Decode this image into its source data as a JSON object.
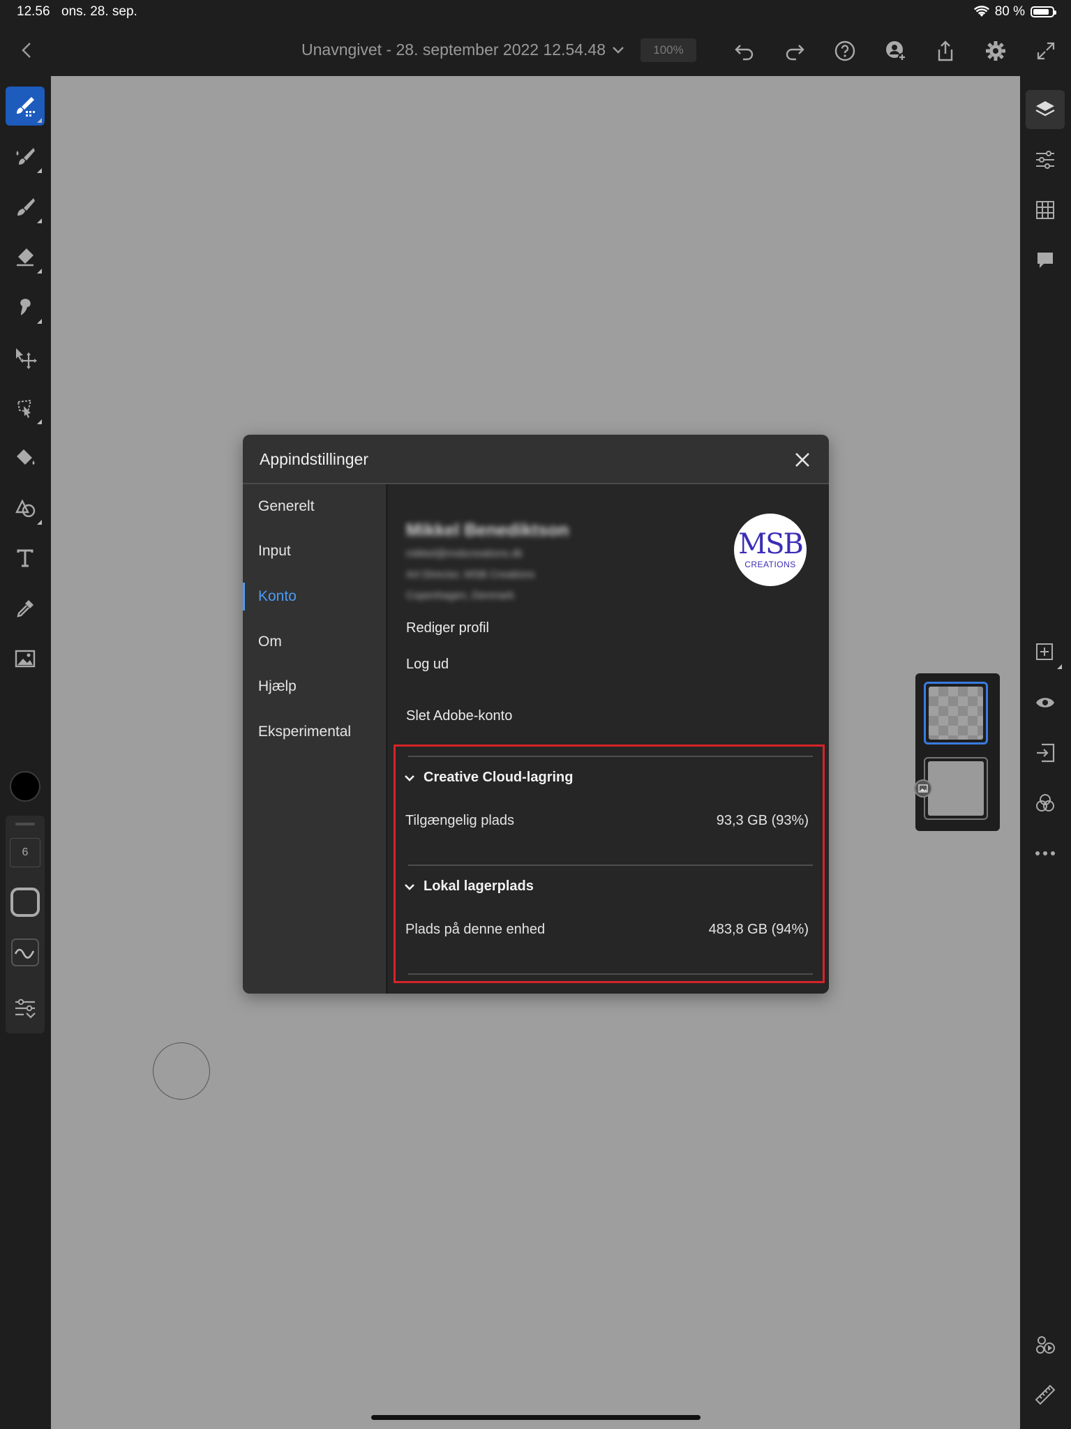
{
  "status_bar": {
    "time": "12.56",
    "date": "ons. 28. sep.",
    "battery": "80 %"
  },
  "app_bar": {
    "document_title": "Unavngivet - 28. september 2022 12.54.48",
    "zoom": "100%"
  },
  "left_toolbar": {
    "brush_size": "6",
    "tools": [
      "pixel-brush",
      "live-brush",
      "vector-brush",
      "eraser",
      "smudge",
      "move",
      "selection",
      "fill",
      "shape",
      "text",
      "eyedropper",
      "image"
    ],
    "active_tool": "pixel-brush"
  },
  "right_toolbar": {
    "icons": [
      "layers",
      "properties",
      "grid",
      "comments",
      "add-layer",
      "visibility",
      "import",
      "blend",
      "more",
      "share-livestream",
      "ruler"
    ]
  },
  "dialog": {
    "title": "Appindstillinger",
    "nav": [
      {
        "label": "Generelt"
      },
      {
        "label": "Input"
      },
      {
        "label": "Konto"
      },
      {
        "label": "Om"
      },
      {
        "label": "Hjælp"
      },
      {
        "label": "Eksperimental"
      }
    ],
    "active_nav": "Konto",
    "profile": {
      "name": "Mikkel Benediktson",
      "email": "mikkel@msbcreations.dk",
      "role": "Art Director, MSB Creations",
      "location": "Copenhagen, Denmark",
      "avatar_monogram": "MSB",
      "avatar_caption": "CREATIONS"
    },
    "account_links": {
      "edit_profile": "Rediger profil",
      "logout": "Log ud",
      "delete_account": "Slet Adobe-konto"
    },
    "storage": {
      "cloud": {
        "heading": "Creative Cloud-lagring",
        "label": "Tilgængelig plads",
        "value": "93,3 GB (93%)"
      },
      "local": {
        "heading": "Lokal lagerplads",
        "label": "Plads på denne enhed",
        "value": "483,8 GB (94%)"
      }
    }
  },
  "colors": {
    "accent_blue": "#4b9cf5",
    "active_tool_blue": "#1d5bbd",
    "highlight_red": "#d8232a",
    "canvas_gray": "#9e9e9e"
  }
}
